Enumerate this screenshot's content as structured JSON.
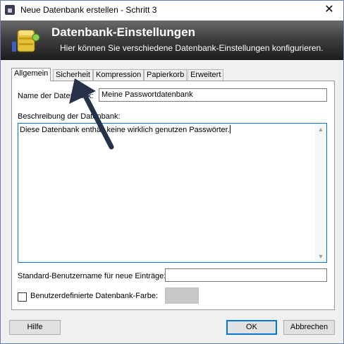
{
  "window": {
    "title": "Neue Datenbank erstellen - Schritt 3",
    "close_glyph": "✕"
  },
  "banner": {
    "title": "Datenbank-Einstellungen",
    "subtitle": "Hier können Sie verschiedene Datenbank-Einstellungen konfigurieren."
  },
  "tabs": [
    {
      "label": "Allgemein",
      "active": true
    },
    {
      "label": "Sicherheit",
      "active": false
    },
    {
      "label": "Kompression",
      "active": false
    },
    {
      "label": "Papierkorb",
      "active": false
    },
    {
      "label": "Erweitert",
      "active": false
    }
  ],
  "general": {
    "name_label": "Name der Datenbank:",
    "name_value": "Meine Passwortdatenbank",
    "description_label": "Beschreibung der Datenbank:",
    "description_value": "Diese Datenbank enthält keine wirklich genutzen Passwörter.",
    "default_username_label": "Standard-Benutzername für neue Einträge:",
    "default_username_value": "",
    "custom_color_label": "Benutzerdefinierte Datenbank-Farbe:",
    "custom_color_checked": false
  },
  "buttons": {
    "help": "Hilfe",
    "ok": "OK",
    "cancel": "Abbrechen"
  },
  "scroll_glyphs": {
    "up": "▲",
    "down": "▼"
  },
  "colors": {
    "banner_dark": "#1c1c1c",
    "focus_blue": "#0078d7",
    "annotation_arrow": "#25324a"
  }
}
